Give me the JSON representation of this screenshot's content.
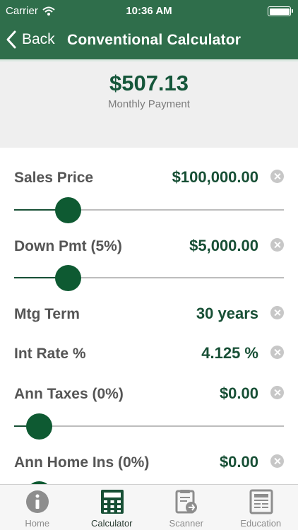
{
  "status": {
    "carrier": "Carrier",
    "time": "10:36 AM",
    "battery_level": 1.0
  },
  "nav": {
    "back_label": "Back",
    "title": "Conventional Calculator"
  },
  "summary": {
    "payment": "$507.13",
    "label": "Monthly Payment"
  },
  "fields": [
    {
      "label": "Sales Price",
      "value": "$100,000.00",
      "slider_level": 0.17
    },
    {
      "label": "Down Pmt (5%)",
      "value": "$5,000.00",
      "slider_level": 0.17
    },
    {
      "label": "Mtg Term",
      "value": "30 years"
    },
    {
      "label": "Int Rate %",
      "value": "4.125 %"
    },
    {
      "label": "Ann Taxes (0%)",
      "value": "$0.00",
      "slider_level": 0.05
    },
    {
      "label": "Ann Home Ins (0%)",
      "value": "$0.00",
      "slider_level": 0.05
    }
  ],
  "tabs": [
    {
      "label": "Home",
      "icon": "info-icon",
      "active": false
    },
    {
      "label": "Calculator",
      "icon": "calculator-icon",
      "active": true
    },
    {
      "label": "Scanner",
      "icon": "scanner-icon",
      "active": false
    },
    {
      "label": "Education",
      "icon": "newspaper-icon",
      "active": false
    }
  ],
  "colors": {
    "brand_green": "#2f6e4b",
    "value_green": "#174f35",
    "thumb_green": "#0e5a32"
  }
}
